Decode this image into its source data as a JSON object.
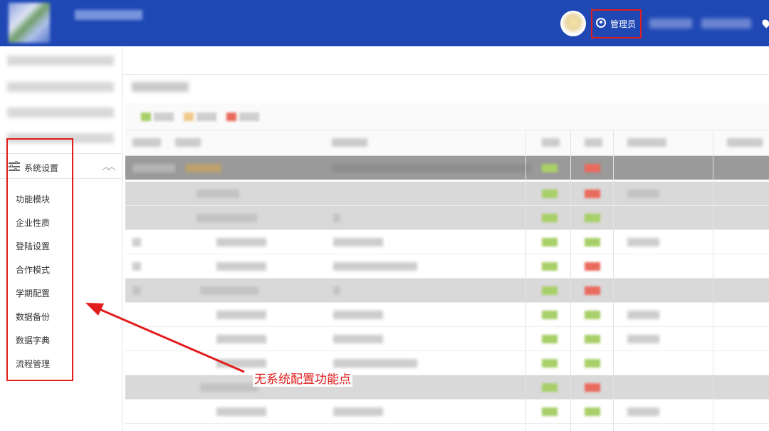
{
  "header": {
    "admin_label": "管理员"
  },
  "sidebar": {
    "section_title": "系统设置",
    "items": [
      {
        "label": "功能模块"
      },
      {
        "label": "企业性质"
      },
      {
        "label": "登陆设置"
      },
      {
        "label": "合作模式"
      },
      {
        "label": "学期配置"
      },
      {
        "label": "数据备份"
      },
      {
        "label": "数据字典"
      },
      {
        "label": "流程管理"
      }
    ]
  },
  "annotation": {
    "text": "无系统配置功能点",
    "color": "#e11d1d"
  },
  "colors": {
    "header_bg": "#1f48b5",
    "highlight_border": "#e11d1d",
    "status_green": "#a8cf68",
    "status_red": "#ea6a5d"
  }
}
